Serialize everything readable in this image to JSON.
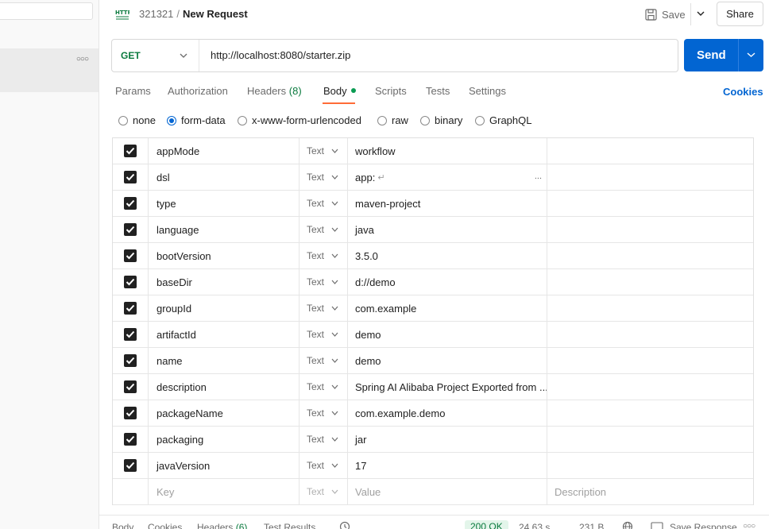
{
  "breadcrumb": {
    "collection": "321321",
    "separator": "/",
    "request_name": "New Request"
  },
  "header": {
    "save_label": "Save",
    "share_label": "Share"
  },
  "request": {
    "method": "GET",
    "url": "http://localhost:8080/starter.zip",
    "send_label": "Send"
  },
  "tabs": [
    {
      "label": "Params"
    },
    {
      "label": "Authorization"
    },
    {
      "label": "Headers",
      "count": "(8)"
    },
    {
      "label": "Body",
      "active": true
    },
    {
      "label": "Scripts"
    },
    {
      "label": "Tests"
    },
    {
      "label": "Settings"
    }
  ],
  "cookies_label": "Cookies",
  "body_types": [
    {
      "label": "none",
      "selected": false
    },
    {
      "label": "form-data",
      "selected": true
    },
    {
      "label": "x-www-form-urlencoded",
      "selected": false
    },
    {
      "label": "raw",
      "selected": false
    },
    {
      "label": "binary",
      "selected": false
    },
    {
      "label": "GraphQL",
      "selected": false
    }
  ],
  "form_rows": [
    {
      "checked": true,
      "key": "appMode",
      "type": "Text",
      "value": "workflow",
      "description": ""
    },
    {
      "checked": true,
      "key": "dsl",
      "type": "Text",
      "value": "app:",
      "description": "",
      "multiline": true
    },
    {
      "checked": true,
      "key": "type",
      "type": "Text",
      "value": "maven-project",
      "description": ""
    },
    {
      "checked": true,
      "key": "language",
      "type": "Text",
      "value": "java",
      "description": ""
    },
    {
      "checked": true,
      "key": "bootVersion",
      "type": "Text",
      "value": "3.5.0",
      "description": ""
    },
    {
      "checked": true,
      "key": "baseDir",
      "type": "Text",
      "value": "d://demo",
      "description": ""
    },
    {
      "checked": true,
      "key": "groupId",
      "type": "Text",
      "value": "com.example",
      "description": ""
    },
    {
      "checked": true,
      "key": "artifactId",
      "type": "Text",
      "value": "demo",
      "description": ""
    },
    {
      "checked": true,
      "key": "name",
      "type": "Text",
      "value": "demo",
      "description": ""
    },
    {
      "checked": true,
      "key": "description",
      "type": "Text",
      "value": "Spring AI Alibaba Project Exported from ...",
      "description": ""
    },
    {
      "checked": true,
      "key": "packageName",
      "type": "Text",
      "value": "com.example.demo",
      "description": ""
    },
    {
      "checked": true,
      "key": "packaging",
      "type": "Text",
      "value": "jar",
      "description": ""
    },
    {
      "checked": true,
      "key": "javaVersion",
      "type": "Text",
      "value": "17",
      "description": ""
    }
  ],
  "new_row": {
    "key_placeholder": "Key",
    "type": "Text",
    "value_placeholder": "Value",
    "description_placeholder": "Description"
  },
  "response_bar": {
    "tabs": [
      {
        "label": "Body"
      },
      {
        "label": "Cookies"
      },
      {
        "label": "Headers",
        "count": "(6)"
      },
      {
        "label": "Test Results"
      }
    ],
    "status": "200 OK",
    "time": "24.63 s",
    "size": "231 B",
    "save_response_label": "Save Response"
  },
  "colors": {
    "accent_blue": "#0265d2",
    "brand_orange": "#ff6c37",
    "green": "#0a7a3e"
  },
  "icons": [
    "http-icon",
    "save-icon",
    "chevron-down-icon",
    "checkbox-checked-icon",
    "history-icon",
    "globe-icon",
    "save-response-icon",
    "more-dots-icon"
  ]
}
